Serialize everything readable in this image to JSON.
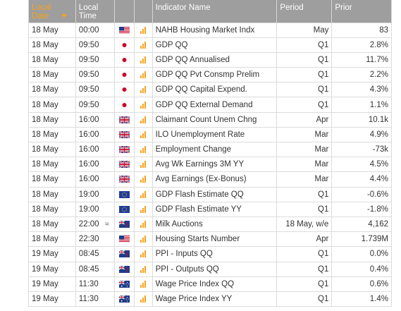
{
  "headers": {
    "date": "Local Date",
    "time": "Local Time",
    "indicator": "Indicator Name",
    "period": "Period",
    "prior": "Prior"
  },
  "rows": [
    {
      "date": "18 May",
      "time": "00:00",
      "country": "us-flag",
      "approx": "",
      "indicator": "NAHB Housing Market Indx",
      "period": "May",
      "prior": "83"
    },
    {
      "date": "18 May",
      "time": "09:50",
      "country": "jp-flag",
      "approx": "",
      "indicator": "GDP QQ",
      "period": "Q1",
      "prior": "2.8%"
    },
    {
      "date": "18 May",
      "time": "09:50",
      "country": "jp-flag",
      "approx": "",
      "indicator": "GDP QQ Annualised",
      "period": "Q1",
      "prior": "11.7%"
    },
    {
      "date": "18 May",
      "time": "09:50",
      "country": "jp-flag",
      "approx": "",
      "indicator": "GDP QQ Pvt Consmp Prelim",
      "period": "Q1",
      "prior": "2.2%"
    },
    {
      "date": "18 May",
      "time": "09:50",
      "country": "jp-flag",
      "approx": "",
      "indicator": "GDP QQ Capital Expend.",
      "period": "Q1",
      "prior": "4.3%"
    },
    {
      "date": "18 May",
      "time": "09:50",
      "country": "jp-flag",
      "approx": "",
      "indicator": "GDP QQ External Demand",
      "period": "Q1",
      "prior": "1.1%"
    },
    {
      "date": "18 May",
      "time": "16:00",
      "country": "uk-flag",
      "approx": "",
      "indicator": "Claimant Count Unem Chng",
      "period": "Apr",
      "prior": "10.1k"
    },
    {
      "date": "18 May",
      "time": "16:00",
      "country": "uk-flag",
      "approx": "",
      "indicator": "ILO Unemployment Rate",
      "period": "Mar",
      "prior": "4.9%"
    },
    {
      "date": "18 May",
      "time": "16:00",
      "country": "uk-flag",
      "approx": "",
      "indicator": "Employment Change",
      "period": "Mar",
      "prior": "-73k"
    },
    {
      "date": "18 May",
      "time": "16:00",
      "country": "uk-flag",
      "approx": "",
      "indicator": "Avg Wk Earnings 3M YY",
      "period": "Mar",
      "prior": "4.5%"
    },
    {
      "date": "18 May",
      "time": "16:00",
      "country": "uk-flag",
      "approx": "",
      "indicator": "Avg Earnings (Ex-Bonus)",
      "period": "Mar",
      "prior": "4.4%"
    },
    {
      "date": "18 May",
      "time": "19:00",
      "country": "eu-flag",
      "approx": "",
      "indicator": "GDP Flash Estimate QQ",
      "period": "Q1",
      "prior": "-0.6%"
    },
    {
      "date": "18 May",
      "time": "19:00",
      "country": "eu-flag",
      "approx": "",
      "indicator": "GDP Flash Estimate YY",
      "period": "Q1",
      "prior": "-1.8%"
    },
    {
      "date": "18 May",
      "time": "22:00",
      "country": "nz-flag",
      "approx": "≈",
      "indicator": "Milk Auctions",
      "period": "18 May, w/e",
      "prior": "4,162"
    },
    {
      "date": "18 May",
      "time": "22:30",
      "country": "us-flag",
      "approx": "",
      "indicator": "Housing Starts Number",
      "period": "Apr",
      "prior": "1.739M"
    },
    {
      "date": "19 May",
      "time": "08:45",
      "country": "nz-flag",
      "approx": "",
      "indicator": "PPI - Inputs QQ",
      "period": "Q1",
      "prior": "0.0%"
    },
    {
      "date": "19 May",
      "time": "08:45",
      "country": "nz-flag",
      "approx": "",
      "indicator": "PPI - Outputs QQ",
      "period": "Q1",
      "prior": "0.4%"
    },
    {
      "date": "19 May",
      "time": "11:30",
      "country": "au-flag",
      "approx": "",
      "indicator": "Wage Price Index QQ",
      "period": "Q1",
      "prior": "0.6%"
    },
    {
      "date": "19 May",
      "time": "11:30",
      "country": "au-flag",
      "approx": "",
      "indicator": "Wage Price Index YY",
      "period": "Q1",
      "prior": "1.4%"
    }
  ],
  "colors": {
    "header_bg": "#9e9e9e",
    "sort_accent": "#f7a21b",
    "impact_bars": "#f7a21b"
  }
}
